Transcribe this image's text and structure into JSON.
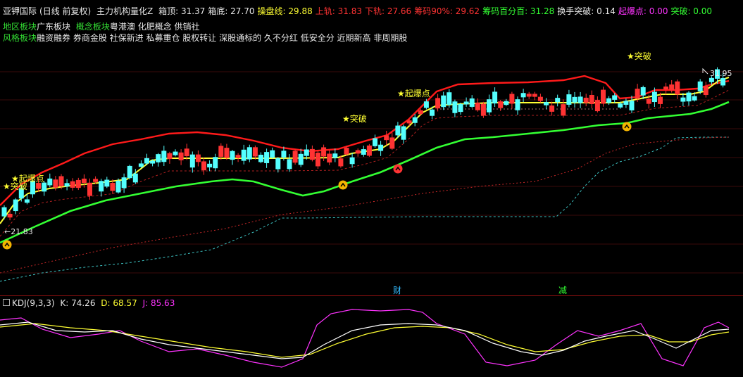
{
  "header": {
    "stock_name": "亚钾国际",
    "period": "(日线 前复权)",
    "indicator": "主力机构量化Z",
    "items": [
      {
        "label": "箱顶:",
        "value": "31.37",
        "color": "#e8e8e8"
      },
      {
        "label": "箱底:",
        "value": "27.70",
        "color": "#e8e8e8"
      },
      {
        "label": "操盘线:",
        "value": "29.88",
        "color": "#ffff33"
      },
      {
        "label": "上轨:",
        "value": "31.83",
        "color": "#ff3333"
      },
      {
        "label": "下轨:",
        "value": "27.66",
        "color": "#ff3333"
      },
      {
        "label": "筹码90%:",
        "value": "29.62",
        "color": "#ff3333"
      },
      {
        "label": "筹码百分百:",
        "value": "31.28",
        "color": "#33ff33"
      },
      {
        "label": "换手突破:",
        "value": "0.14",
        "color": "#e8e8e8"
      },
      {
        "label": "起爆点:",
        "value": "0.00",
        "color": "#ff33ff"
      },
      {
        "label": "突破:",
        "value": "0.00",
        "color": "#33ff33"
      }
    ]
  },
  "sectors": {
    "region_label": "地区板块",
    "region_value": "广东板块",
    "concept_label": "概念板块",
    "concept_value": "粤港澳 化肥概念 供销社",
    "style_label": "风格板块",
    "style_value": "融资融券 券商金股 社保新进 私募重仓 股权转让 深股通标的 久不分红 低安全分 近期新高 非周期股"
  },
  "annotations": {
    "breakout": "★突破",
    "ignition": "★起爆点",
    "low_price": "←21.83",
    "high_price": "31.95",
    "marker_cai": "财",
    "marker_jian": "减"
  },
  "kdj": {
    "name": "KDJ(9,3,3)",
    "k": "K: 74.26",
    "d": "D: 68.57",
    "j": "J: 85.63"
  },
  "colors": {
    "up": "#ff3333",
    "down": "#54ffff",
    "upper_band": "#ff1a1a",
    "operating_line": "#ffff33",
    "trend_line": "#33ff33",
    "k_line": "#ffffff",
    "d_line": "#ffff33",
    "j_line": "#ff33ff"
  }
}
